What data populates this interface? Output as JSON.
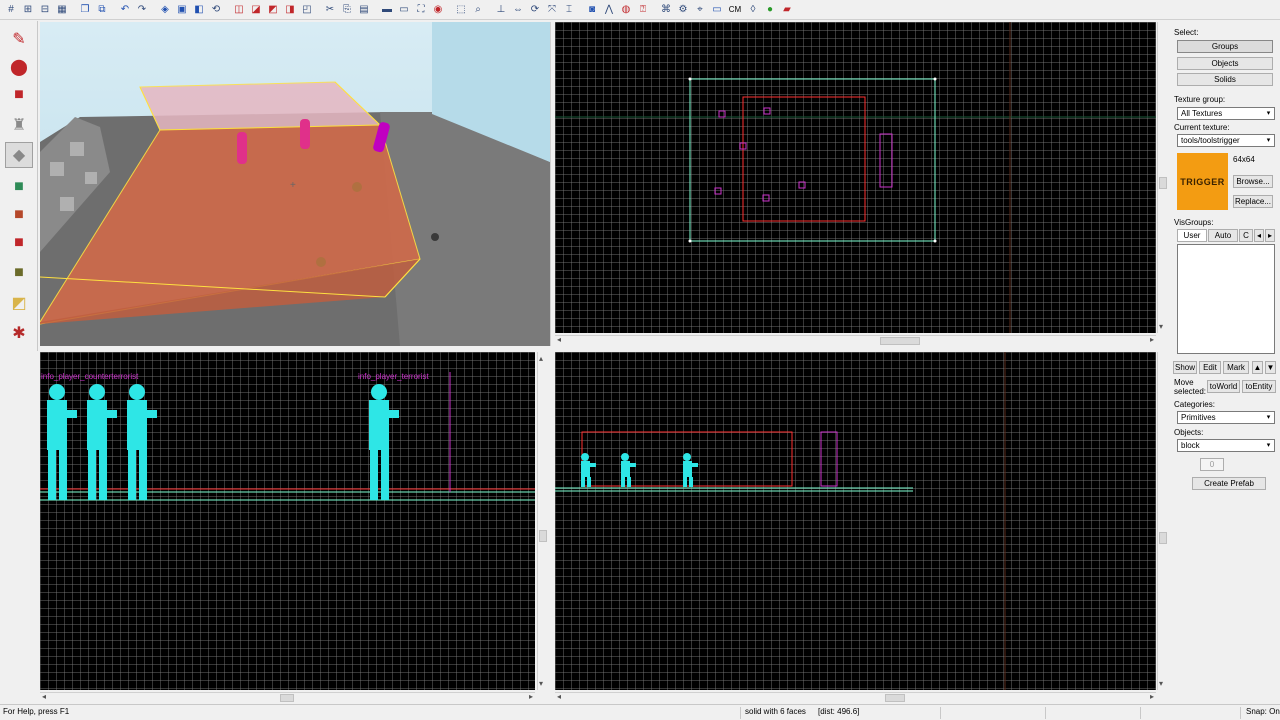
{
  "toolbar": {
    "cm_label": "CM"
  },
  "right_panel": {
    "select_label": "Select:",
    "groups_btn": "Groups",
    "objects_btn": "Objects",
    "solids_btn": "Solids",
    "texture_group_label": "Texture group:",
    "texture_group_value": "All Textures",
    "current_texture_label": "Current texture:",
    "current_texture_value": "tools/toolstrigger",
    "texture_size": "64x64",
    "texture_swatch_text": "TRIGGER",
    "browse_btn": "Browse...",
    "replace_btn": "Replace...",
    "visgroups_label": "VisGroups:",
    "tab_user": "User",
    "tab_auto": "Auto",
    "tab_c": "C",
    "show_btn": "Show",
    "edit_btn": "Edit",
    "mark_btn": "Mark",
    "move_selected_label": "Move selected:",
    "to_world_btn": "toWorld",
    "to_entity_btn": "toEntity",
    "categories_label": "Categories:",
    "categories_value": "Primitives",
    "objects_label": "Objects:",
    "objects_value": "block",
    "faces_value": "0",
    "create_prefab_btn": "Create Prefab"
  },
  "viewports": {
    "front_label_1": "info_player_counterterrorist",
    "front_label_2": "info_player_terrorist"
  },
  "statusbar": {
    "help": "For Help, press F1",
    "selection": "solid with 6 faces",
    "dist": "[dist: 496.6]",
    "snap": "Snap: On"
  },
  "colors": {
    "trigger_orange": "#f39c12",
    "grid_line": "#787878",
    "selection_green": "#7fffd4",
    "selection_red": "#ff3030",
    "entity_magenta": "#cc33cc",
    "player_cyan": "#2ee6e6"
  }
}
